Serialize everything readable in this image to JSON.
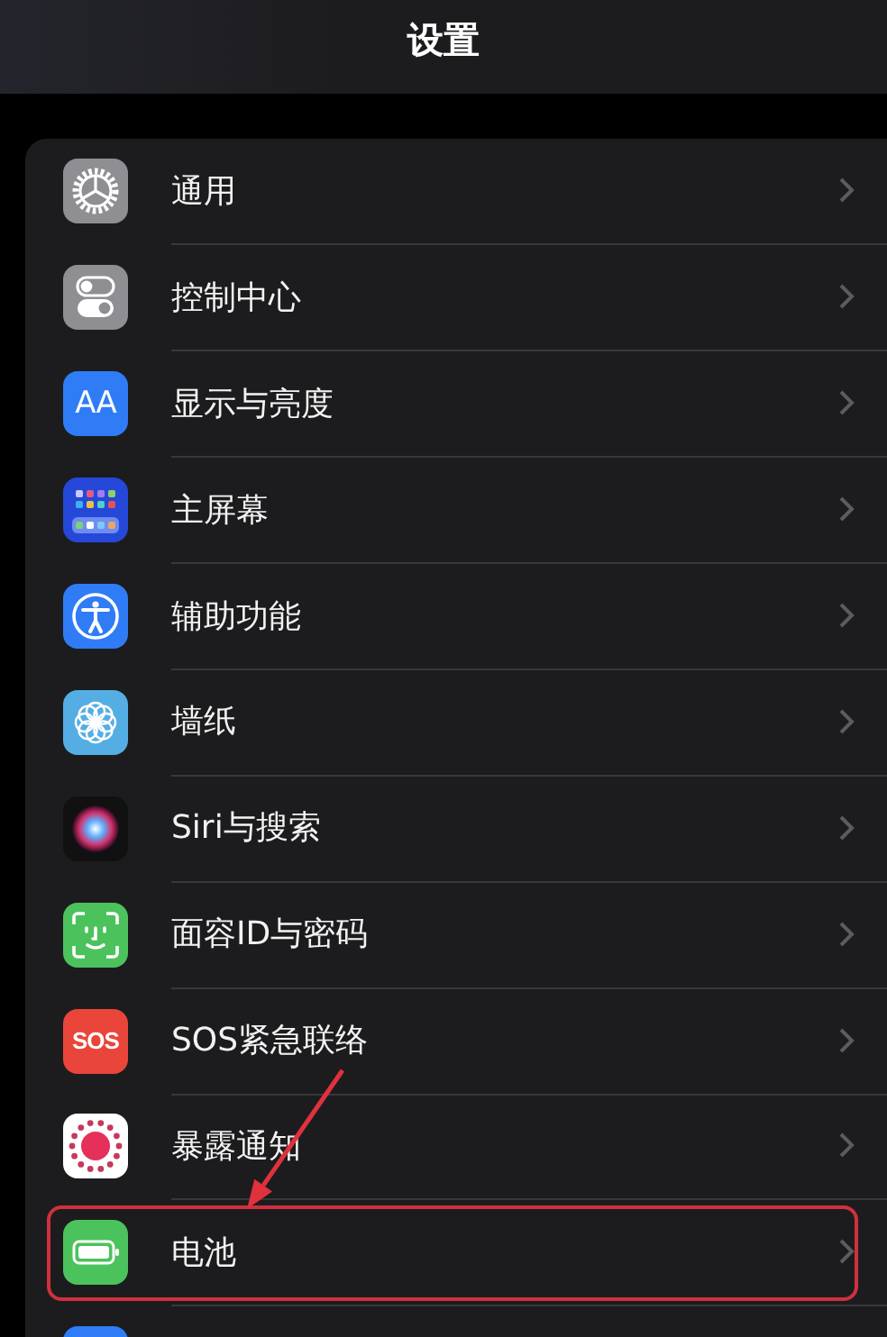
{
  "header": {
    "title": "设置"
  },
  "items": [
    {
      "label": "通用",
      "highlighted": false
    },
    {
      "label": "控制中心",
      "highlighted": false
    },
    {
      "label": "显示与亮度",
      "icon_text": "AA",
      "highlighted": false
    },
    {
      "label": "主屏幕",
      "highlighted": false
    },
    {
      "label": "辅助功能",
      "highlighted": false
    },
    {
      "label": "墙纸",
      "highlighted": false
    },
    {
      "label": "Siri与搜索",
      "highlighted": false
    },
    {
      "label": "面容ID与密码",
      "highlighted": false
    },
    {
      "label": "SOS紧急联络",
      "icon_text": "SOS",
      "highlighted": false
    },
    {
      "label": "暴露通知",
      "highlighted": false
    },
    {
      "label": "电池",
      "highlighted": true
    },
    {
      "highlighted": false
    }
  ]
}
